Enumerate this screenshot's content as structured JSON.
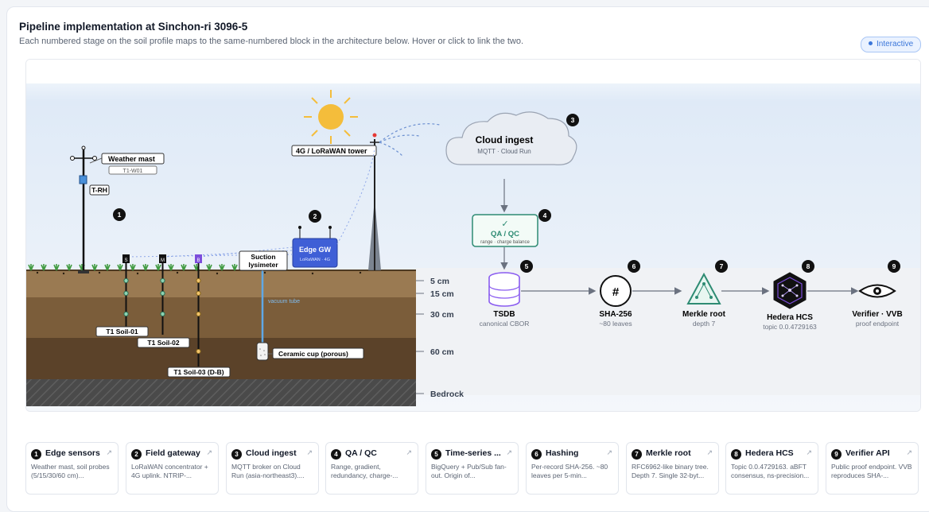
{
  "header": {
    "title": "Pipeline implementation at Sinchon-ri 3096-5",
    "subtitle": "Each numbered stage on the soil profile maps to the same-numbered block in the architecture below. Hover or click to link the two.",
    "badge": "Interactive"
  },
  "diagram": {
    "weather_mast": {
      "label": "Weather mast",
      "id": "T1-W01",
      "sensor": "T-RH"
    },
    "tower": {
      "label": "4G / LoRaWAN tower"
    },
    "cloud": {
      "title": "Cloud ingest",
      "sub": "MQTT · Cloud Run"
    },
    "qa": {
      "check": "✓",
      "title": "QA / QC",
      "sub": "range · charge balance"
    },
    "gateway": {
      "title": "Edge GW",
      "sub": "LoRaWAN · 4G"
    },
    "lysimeter": {
      "line1": "Suction",
      "line2": "lysimeter",
      "tube": "vacuum tube",
      "cup": "Ceramic cup (porous)"
    },
    "probes": [
      "T1 Soil-01",
      "T1 Soil-02",
      "T1 Soil-03 (D-B)"
    ],
    "probe_tags": [
      "S",
      "M",
      "B"
    ],
    "depths": [
      "5 cm",
      "15 cm",
      "30 cm",
      "60 cm",
      "Bedrock"
    ],
    "stage_numbers": [
      "1",
      "2",
      "3",
      "4",
      "5",
      "6",
      "7",
      "8",
      "9"
    ],
    "tsdb": {
      "title": "TSDB",
      "sub": "canonical CBOR"
    },
    "sha": {
      "glyph": "#",
      "title": "SHA-256",
      "sub": "~80 leaves"
    },
    "merkle": {
      "title": "Merkle root",
      "sub": "depth 7"
    },
    "hedera": {
      "title": "Hedera HCS",
      "sub": "topic 0.0.4729163"
    },
    "verifier": {
      "title": "Verifier · VVB",
      "sub": "proof endpoint"
    }
  },
  "stage_cards": [
    {
      "num": "1",
      "title": "Edge sensors",
      "desc": "Weather mast, soil probes (5/15/30/60 cm)..."
    },
    {
      "num": "2",
      "title": "Field gateway",
      "desc": "LoRaWAN concentrator + 4G uplink. NTRIP-..."
    },
    {
      "num": "3",
      "title": "Cloud ingest",
      "desc": "MQTT broker on Cloud Run (asia-northeast3)...."
    },
    {
      "num": "4",
      "title": "QA / QC",
      "desc": "Range, gradient, redundancy, charge-..."
    },
    {
      "num": "5",
      "title": "Time-series ...",
      "desc": "BigQuery + Pub/Sub fan-out. Origin of..."
    },
    {
      "num": "6",
      "title": "Hashing",
      "desc": "Per-record SHA-256. ~80 leaves per 5-min..."
    },
    {
      "num": "7",
      "title": "Merkle root",
      "desc": "RFC6962-like binary tree. Depth 7. Single 32-byt..."
    },
    {
      "num": "8",
      "title": "Hedera HCS",
      "desc": "Topic 0.0.4729163. aBFT consensus, ns-precision..."
    },
    {
      "num": "9",
      "title": "Verifier API",
      "desc": "Public proof endpoint. VVB reproduces SHA-..."
    }
  ],
  "colors": {
    "accent": "#3b76d9",
    "qa_green": "#2e8b73",
    "tsdb_purple": "#8a5cf0",
    "gateway_blue": "#3f5fd6"
  },
  "icons": {
    "card_link": "external-link-icon"
  }
}
